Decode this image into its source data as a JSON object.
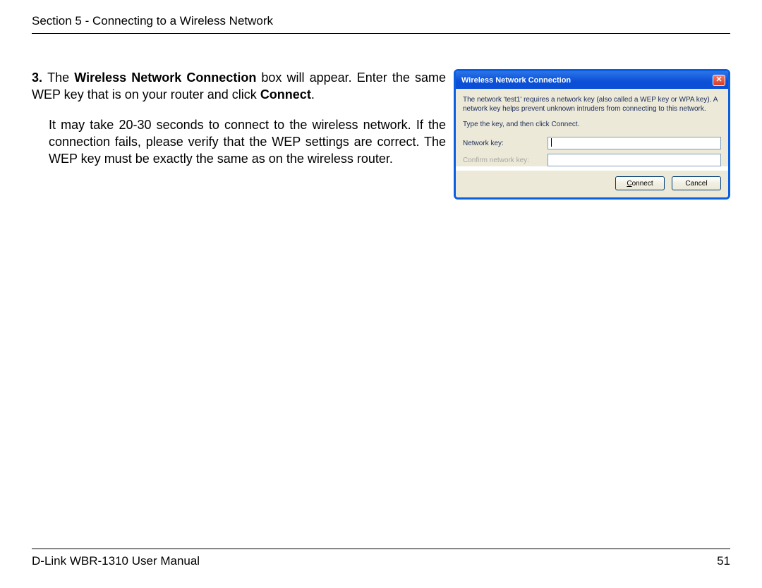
{
  "header": {
    "section_line": "Section 5 - Connecting to a Wireless Network"
  },
  "content": {
    "step_number": "3. ",
    "step_prefix": "The ",
    "step_bold1": "Wireless Network Connection",
    "step_mid": " box will appear. Enter the same WEP key that is on your router and click ",
    "step_bold2": "Connect",
    "step_suffix": ".",
    "para2": "It may take 20-30 seconds to connect to the wireless network. If the connection fails, please verify that the WEP settings are correct. The WEP key must be exactly the same as on the wireless router."
  },
  "dialog": {
    "title": "Wireless Network Connection",
    "info": "The network 'test1' requires a network key (also called a WEP key or WPA key). A network key helps prevent unknown intruders from connecting to this network.",
    "instruct": "Type the key, and then click Connect.",
    "label_key": "Network key:",
    "label_confirm": "Confirm network key:",
    "connect_u": "C",
    "connect_rest": "onnect",
    "cancel": "Cancel"
  },
  "footer": {
    "left": "D-Link WBR-1310 User Manual",
    "right": "51"
  }
}
